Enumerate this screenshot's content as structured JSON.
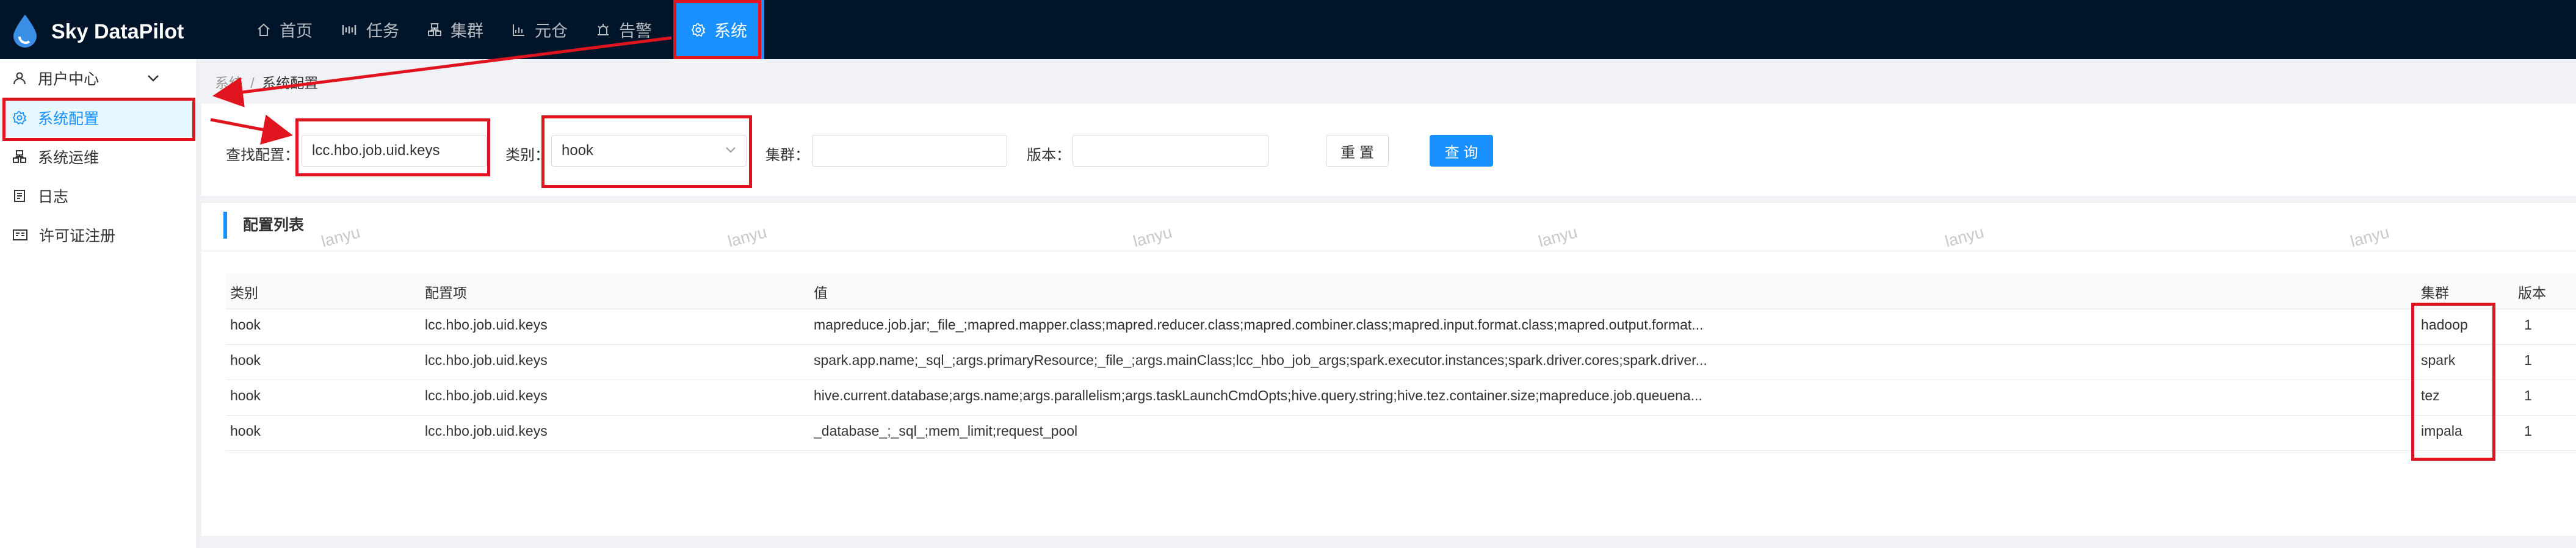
{
  "app": {
    "title": "Sky DataPilot"
  },
  "nav": [
    {
      "label": "首页",
      "icon": "home-icon"
    },
    {
      "label": "任务",
      "icon": "task-icon"
    },
    {
      "label": "集群",
      "icon": "cluster-icon"
    },
    {
      "label": "元仓",
      "icon": "chart-icon"
    },
    {
      "label": "告警",
      "icon": "alarm-icon"
    },
    {
      "label": "系统",
      "icon": "gear-icon"
    }
  ],
  "sidebar": {
    "items": [
      {
        "label": "用户中心",
        "icon": "user-icon"
      },
      {
        "label": "系统配置",
        "icon": "settings-icon"
      },
      {
        "label": "系统运维",
        "icon": "ops-icon"
      },
      {
        "label": "日志",
        "icon": "log-icon"
      },
      {
        "label": "许可证注册",
        "icon": "license-icon"
      }
    ]
  },
  "breadcrumb": {
    "parent": "系统",
    "separator": "/",
    "current": "系统配置"
  },
  "filters": {
    "search_label": "查找配置：",
    "search_value": "lcc.hbo.job.uid.keys",
    "category_label": "类别：",
    "category_value": "hook",
    "cluster_label": "集群：",
    "cluster_value": "",
    "version_label": "版本：",
    "version_value": "",
    "reset_label": "重 置",
    "query_label": "查 询"
  },
  "list": {
    "title": "配置列表",
    "watermark": "lanyu",
    "columns": [
      "类别",
      "配置项",
      "值",
      "集群",
      "版本"
    ],
    "rows": [
      {
        "category": "hook",
        "key": "lcc.hbo.job.uid.keys",
        "value": "mapreduce.job.jar;_file_;mapred.mapper.class;mapred.reducer.class;mapred.combiner.class;mapred.input.format.class;mapred.output.format...",
        "cluster": "hadoop",
        "version": "1"
      },
      {
        "category": "hook",
        "key": "lcc.hbo.job.uid.keys",
        "value": "spark.app.name;_sql_;args.primaryResource;_file_;args.mainClass;lcc_hbo_job_args;spark.executor.instances;spark.driver.cores;spark.driver...",
        "cluster": "spark",
        "version": "1"
      },
      {
        "category": "hook",
        "key": "lcc.hbo.job.uid.keys",
        "value": "hive.current.database;args.name;args.parallelism;args.taskLaunchCmdOpts;hive.query.string;hive.tez.container.size;mapreduce.job.queuena...",
        "cluster": "tez",
        "version": "1"
      },
      {
        "category": "hook",
        "key": "lcc.hbo.job.uid.keys",
        "value": "_database_;_sql_;mem_limit;request_pool",
        "cluster": "impala",
        "version": "1"
      }
    ]
  },
  "colors": {
    "header_bg": "#001529",
    "accent": "#1890ff",
    "annotation_red": "#e0141e"
  }
}
